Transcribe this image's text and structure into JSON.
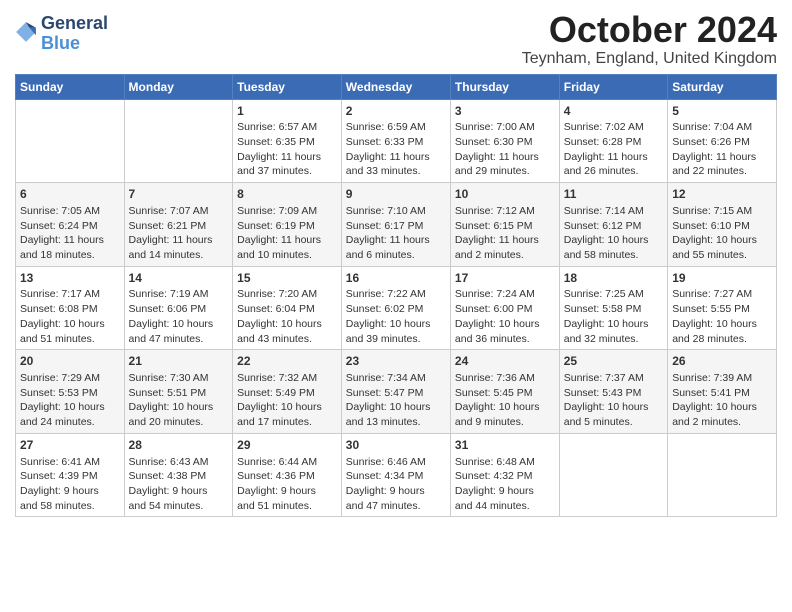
{
  "header": {
    "logo_general": "General",
    "logo_blue": "Blue",
    "month_title": "October 2024",
    "location": "Teynham, England, United Kingdom"
  },
  "calendar": {
    "days_of_week": [
      "Sunday",
      "Monday",
      "Tuesday",
      "Wednesday",
      "Thursday",
      "Friday",
      "Saturday"
    ],
    "weeks": [
      [
        {
          "day": "",
          "content": ""
        },
        {
          "day": "",
          "content": ""
        },
        {
          "day": "1",
          "content": "Sunrise: 6:57 AM\nSunset: 6:35 PM\nDaylight: 11 hours\nand 37 minutes."
        },
        {
          "day": "2",
          "content": "Sunrise: 6:59 AM\nSunset: 6:33 PM\nDaylight: 11 hours\nand 33 minutes."
        },
        {
          "day": "3",
          "content": "Sunrise: 7:00 AM\nSunset: 6:30 PM\nDaylight: 11 hours\nand 29 minutes."
        },
        {
          "day": "4",
          "content": "Sunrise: 7:02 AM\nSunset: 6:28 PM\nDaylight: 11 hours\nand 26 minutes."
        },
        {
          "day": "5",
          "content": "Sunrise: 7:04 AM\nSunset: 6:26 PM\nDaylight: 11 hours\nand 22 minutes."
        }
      ],
      [
        {
          "day": "6",
          "content": "Sunrise: 7:05 AM\nSunset: 6:24 PM\nDaylight: 11 hours\nand 18 minutes."
        },
        {
          "day": "7",
          "content": "Sunrise: 7:07 AM\nSunset: 6:21 PM\nDaylight: 11 hours\nand 14 minutes."
        },
        {
          "day": "8",
          "content": "Sunrise: 7:09 AM\nSunset: 6:19 PM\nDaylight: 11 hours\nand 10 minutes."
        },
        {
          "day": "9",
          "content": "Sunrise: 7:10 AM\nSunset: 6:17 PM\nDaylight: 11 hours\nand 6 minutes."
        },
        {
          "day": "10",
          "content": "Sunrise: 7:12 AM\nSunset: 6:15 PM\nDaylight: 11 hours\nand 2 minutes."
        },
        {
          "day": "11",
          "content": "Sunrise: 7:14 AM\nSunset: 6:12 PM\nDaylight: 10 hours\nand 58 minutes."
        },
        {
          "day": "12",
          "content": "Sunrise: 7:15 AM\nSunset: 6:10 PM\nDaylight: 10 hours\nand 55 minutes."
        }
      ],
      [
        {
          "day": "13",
          "content": "Sunrise: 7:17 AM\nSunset: 6:08 PM\nDaylight: 10 hours\nand 51 minutes."
        },
        {
          "day": "14",
          "content": "Sunrise: 7:19 AM\nSunset: 6:06 PM\nDaylight: 10 hours\nand 47 minutes."
        },
        {
          "day": "15",
          "content": "Sunrise: 7:20 AM\nSunset: 6:04 PM\nDaylight: 10 hours\nand 43 minutes."
        },
        {
          "day": "16",
          "content": "Sunrise: 7:22 AM\nSunset: 6:02 PM\nDaylight: 10 hours\nand 39 minutes."
        },
        {
          "day": "17",
          "content": "Sunrise: 7:24 AM\nSunset: 6:00 PM\nDaylight: 10 hours\nand 36 minutes."
        },
        {
          "day": "18",
          "content": "Sunrise: 7:25 AM\nSunset: 5:58 PM\nDaylight: 10 hours\nand 32 minutes."
        },
        {
          "day": "19",
          "content": "Sunrise: 7:27 AM\nSunset: 5:55 PM\nDaylight: 10 hours\nand 28 minutes."
        }
      ],
      [
        {
          "day": "20",
          "content": "Sunrise: 7:29 AM\nSunset: 5:53 PM\nDaylight: 10 hours\nand 24 minutes."
        },
        {
          "day": "21",
          "content": "Sunrise: 7:30 AM\nSunset: 5:51 PM\nDaylight: 10 hours\nand 20 minutes."
        },
        {
          "day": "22",
          "content": "Sunrise: 7:32 AM\nSunset: 5:49 PM\nDaylight: 10 hours\nand 17 minutes."
        },
        {
          "day": "23",
          "content": "Sunrise: 7:34 AM\nSunset: 5:47 PM\nDaylight: 10 hours\nand 13 minutes."
        },
        {
          "day": "24",
          "content": "Sunrise: 7:36 AM\nSunset: 5:45 PM\nDaylight: 10 hours\nand 9 minutes."
        },
        {
          "day": "25",
          "content": "Sunrise: 7:37 AM\nSunset: 5:43 PM\nDaylight: 10 hours\nand 5 minutes."
        },
        {
          "day": "26",
          "content": "Sunrise: 7:39 AM\nSunset: 5:41 PM\nDaylight: 10 hours\nand 2 minutes."
        }
      ],
      [
        {
          "day": "27",
          "content": "Sunrise: 6:41 AM\nSunset: 4:39 PM\nDaylight: 9 hours\nand 58 minutes."
        },
        {
          "day": "28",
          "content": "Sunrise: 6:43 AM\nSunset: 4:38 PM\nDaylight: 9 hours\nand 54 minutes."
        },
        {
          "day": "29",
          "content": "Sunrise: 6:44 AM\nSunset: 4:36 PM\nDaylight: 9 hours\nand 51 minutes."
        },
        {
          "day": "30",
          "content": "Sunrise: 6:46 AM\nSunset: 4:34 PM\nDaylight: 9 hours\nand 47 minutes."
        },
        {
          "day": "31",
          "content": "Sunrise: 6:48 AM\nSunset: 4:32 PM\nDaylight: 9 hours\nand 44 minutes."
        },
        {
          "day": "",
          "content": ""
        },
        {
          "day": "",
          "content": ""
        }
      ]
    ]
  }
}
